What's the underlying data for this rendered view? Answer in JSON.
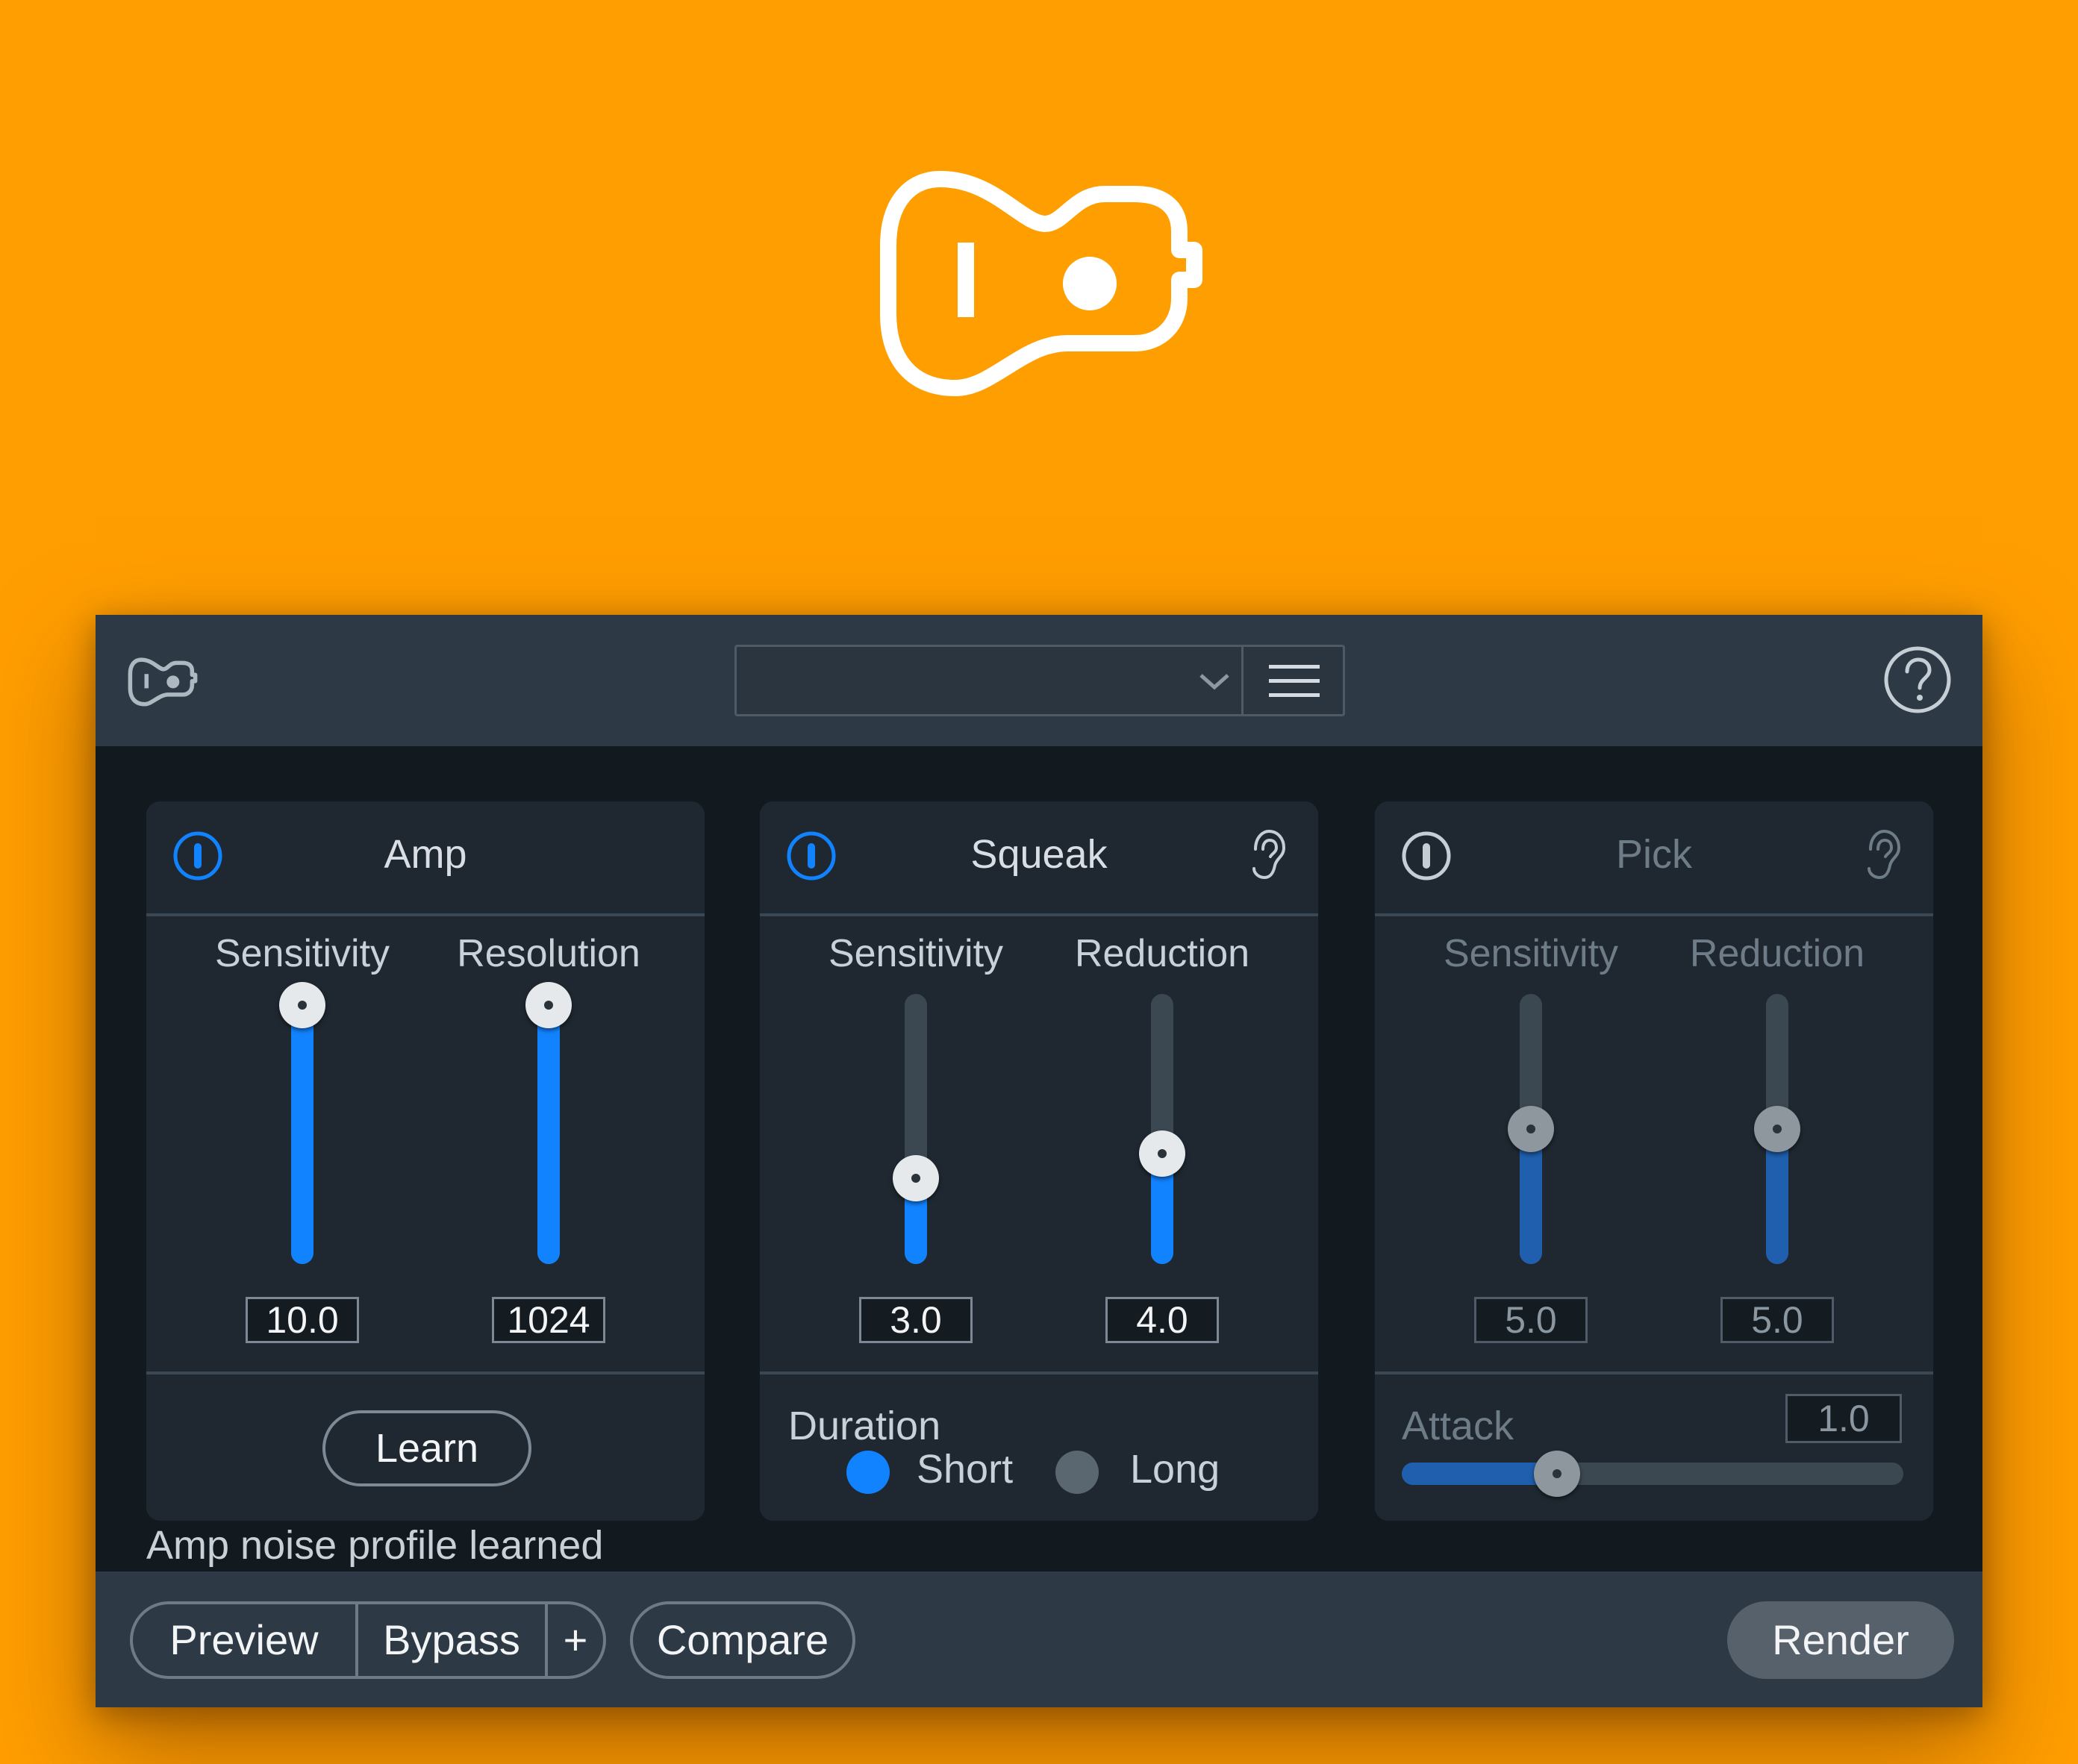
{
  "brand": {
    "background": "#FF9E00",
    "accent": "#1283FF"
  },
  "header": {
    "logo_icon": "guitar-icon",
    "preset_value": "",
    "menu_icon": "hamburger-icon",
    "help_icon": "help-icon"
  },
  "modules": {
    "amp": {
      "title": "Amp",
      "enabled": true,
      "sliders": [
        {
          "label": "Sensitivity",
          "value": "10.0",
          "level": 1.0
        },
        {
          "label": "Resolution",
          "value": "1024",
          "level": 1.0
        }
      ],
      "learn_label": "Learn"
    },
    "squeak": {
      "title": "Squeak",
      "enabled": true,
      "sliders": [
        {
          "label": "Sensitivity",
          "value": "3.0",
          "level": 0.3
        },
        {
          "label": "Reduction",
          "value": "4.0",
          "level": 0.4
        }
      ],
      "duration": {
        "label": "Duration",
        "options": [
          {
            "label": "Short",
            "selected": true
          },
          {
            "label": "Long",
            "selected": false
          }
        ]
      }
    },
    "pick": {
      "title": "Pick",
      "enabled": false,
      "sliders": [
        {
          "label": "Sensitivity",
          "value": "5.0",
          "level": 0.5
        },
        {
          "label": "Reduction",
          "value": "5.0",
          "level": 0.5
        }
      ],
      "attack": {
        "label": "Attack",
        "value": "1.0",
        "level": 0.31
      }
    }
  },
  "status_text": "Amp noise profile learned",
  "footer": {
    "preview": "Preview",
    "bypass": "Bypass",
    "plus": "+",
    "compare": "Compare",
    "render": "Render"
  }
}
